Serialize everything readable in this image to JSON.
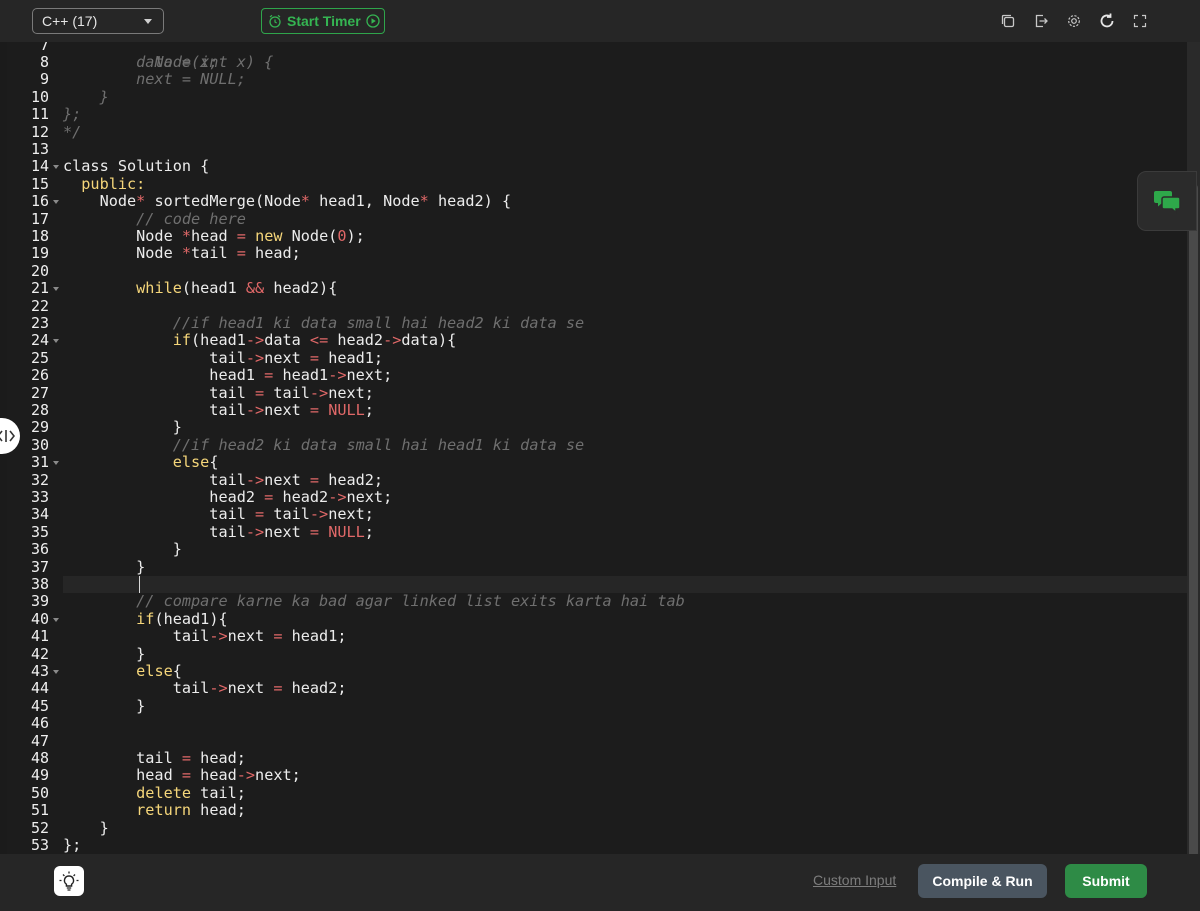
{
  "toolbar": {
    "language": "C++ (17)",
    "timer_label": "Start Timer",
    "icons": [
      "copy-icon",
      "export-icon",
      "settings-icon",
      "reset-icon",
      "fullscreen-icon"
    ]
  },
  "editor": {
    "first_line_partial": "    Node(int x) {",
    "active_line": 38,
    "lines": [
      {
        "n": 8,
        "fold": false,
        "tokens": [
          [
            "cm",
            "        data = x;"
          ]
        ]
      },
      {
        "n": 9,
        "fold": false,
        "tokens": [
          [
            "cm",
            "        next = NULL;"
          ]
        ]
      },
      {
        "n": 10,
        "fold": false,
        "tokens": [
          [
            "cm",
            "    }"
          ]
        ]
      },
      {
        "n": 11,
        "fold": false,
        "tokens": [
          [
            "cm",
            "};"
          ]
        ]
      },
      {
        "n": 12,
        "fold": false,
        "tokens": [
          [
            "cm",
            "*/"
          ]
        ]
      },
      {
        "n": 13,
        "fold": false,
        "tokens": []
      },
      {
        "n": 14,
        "fold": true,
        "tokens": [
          [
            "plain",
            "class Solution {"
          ]
        ]
      },
      {
        "n": 15,
        "fold": false,
        "tokens": [
          [
            "kw",
            "  public:"
          ]
        ]
      },
      {
        "n": 16,
        "fold": true,
        "tokens": [
          [
            "plain",
            "    Node"
          ],
          [
            "op",
            "*"
          ],
          [
            "plain",
            " sortedMerge(Node"
          ],
          [
            "op",
            "*"
          ],
          [
            "plain",
            " head1, Node"
          ],
          [
            "op",
            "*"
          ],
          [
            "plain",
            " head2) {"
          ]
        ]
      },
      {
        "n": 17,
        "fold": false,
        "tokens": [
          [
            "cm",
            "        // code here"
          ]
        ]
      },
      {
        "n": 18,
        "fold": false,
        "tokens": [
          [
            "plain",
            "        Node "
          ],
          [
            "op",
            "*"
          ],
          [
            "plain",
            "head "
          ],
          [
            "op",
            "="
          ],
          [
            "plain",
            " "
          ],
          [
            "kw",
            "new"
          ],
          [
            "plain",
            " Node("
          ],
          [
            "num",
            "0"
          ],
          [
            "plain",
            ");"
          ]
        ]
      },
      {
        "n": 19,
        "fold": false,
        "tokens": [
          [
            "plain",
            "        Node "
          ],
          [
            "op",
            "*"
          ],
          [
            "plain",
            "tail "
          ],
          [
            "op",
            "="
          ],
          [
            "plain",
            " head;"
          ]
        ]
      },
      {
        "n": 20,
        "fold": false,
        "tokens": []
      },
      {
        "n": 21,
        "fold": true,
        "tokens": [
          [
            "plain",
            "        "
          ],
          [
            "kw",
            "while"
          ],
          [
            "plain",
            "(head1 "
          ],
          [
            "op",
            "&&"
          ],
          [
            "plain",
            " head2){"
          ]
        ]
      },
      {
        "n": 22,
        "fold": false,
        "tokens": []
      },
      {
        "n": 23,
        "fold": false,
        "tokens": [
          [
            "cm",
            "            //if head1 ki data small hai head2 ki data se"
          ]
        ]
      },
      {
        "n": 24,
        "fold": true,
        "tokens": [
          [
            "plain",
            "            "
          ],
          [
            "kw",
            "if"
          ],
          [
            "plain",
            "(head1"
          ],
          [
            "op",
            "->"
          ],
          [
            "plain",
            "data "
          ],
          [
            "op",
            "<="
          ],
          [
            "plain",
            " head2"
          ],
          [
            "op",
            "->"
          ],
          [
            "plain",
            "data){"
          ]
        ]
      },
      {
        "n": 25,
        "fold": false,
        "tokens": [
          [
            "plain",
            "                tail"
          ],
          [
            "op",
            "->"
          ],
          [
            "plain",
            "next "
          ],
          [
            "op",
            "="
          ],
          [
            "plain",
            " head1;"
          ]
        ]
      },
      {
        "n": 26,
        "fold": false,
        "tokens": [
          [
            "plain",
            "                head1 "
          ],
          [
            "op",
            "="
          ],
          [
            "plain",
            " head1"
          ],
          [
            "op",
            "->"
          ],
          [
            "plain",
            "next;"
          ]
        ]
      },
      {
        "n": 27,
        "fold": false,
        "tokens": [
          [
            "plain",
            "                tail "
          ],
          [
            "op",
            "="
          ],
          [
            "plain",
            " tail"
          ],
          [
            "op",
            "->"
          ],
          [
            "plain",
            "next;"
          ]
        ]
      },
      {
        "n": 28,
        "fold": false,
        "tokens": [
          [
            "plain",
            "                tail"
          ],
          [
            "op",
            "->"
          ],
          [
            "plain",
            "next "
          ],
          [
            "op",
            "="
          ],
          [
            "plain",
            " "
          ],
          [
            "null",
            "NULL"
          ],
          [
            "plain",
            ";"
          ]
        ]
      },
      {
        "n": 29,
        "fold": false,
        "tokens": [
          [
            "plain",
            "            }"
          ]
        ]
      },
      {
        "n": 30,
        "fold": false,
        "tokens": [
          [
            "cm",
            "            //if head2 ki data small hai head1 ki data se"
          ]
        ]
      },
      {
        "n": 31,
        "fold": true,
        "tokens": [
          [
            "plain",
            "            "
          ],
          [
            "kw",
            "else"
          ],
          [
            "plain",
            "{"
          ]
        ]
      },
      {
        "n": 32,
        "fold": false,
        "tokens": [
          [
            "plain",
            "                tail"
          ],
          [
            "op",
            "->"
          ],
          [
            "plain",
            "next "
          ],
          [
            "op",
            "="
          ],
          [
            "plain",
            " head2;"
          ]
        ]
      },
      {
        "n": 33,
        "fold": false,
        "tokens": [
          [
            "plain",
            "                head2 "
          ],
          [
            "op",
            "="
          ],
          [
            "plain",
            " head2"
          ],
          [
            "op",
            "->"
          ],
          [
            "plain",
            "next;"
          ]
        ]
      },
      {
        "n": 34,
        "fold": false,
        "tokens": [
          [
            "plain",
            "                tail "
          ],
          [
            "op",
            "="
          ],
          [
            "plain",
            " tail"
          ],
          [
            "op",
            "->"
          ],
          [
            "plain",
            "next;"
          ]
        ]
      },
      {
        "n": 35,
        "fold": false,
        "tokens": [
          [
            "plain",
            "                tail"
          ],
          [
            "op",
            "->"
          ],
          [
            "plain",
            "next "
          ],
          [
            "op",
            "="
          ],
          [
            "plain",
            " "
          ],
          [
            "null",
            "NULL"
          ],
          [
            "plain",
            ";"
          ]
        ]
      },
      {
        "n": 36,
        "fold": false,
        "tokens": [
          [
            "plain",
            "            }"
          ]
        ]
      },
      {
        "n": 37,
        "fold": false,
        "tokens": [
          [
            "plain",
            "        }"
          ]
        ]
      },
      {
        "n": 38,
        "fold": false,
        "tokens": []
      },
      {
        "n": 39,
        "fold": false,
        "tokens": [
          [
            "cm",
            "        // compare karne ka bad agar linked list exits karta hai tab"
          ]
        ]
      },
      {
        "n": 40,
        "fold": true,
        "tokens": [
          [
            "plain",
            "        "
          ],
          [
            "kw",
            "if"
          ],
          [
            "plain",
            "(head1){"
          ]
        ]
      },
      {
        "n": 41,
        "fold": false,
        "tokens": [
          [
            "plain",
            "            tail"
          ],
          [
            "op",
            "->"
          ],
          [
            "plain",
            "next "
          ],
          [
            "op",
            "="
          ],
          [
            "plain",
            " head1;"
          ]
        ]
      },
      {
        "n": 42,
        "fold": false,
        "tokens": [
          [
            "plain",
            "        }"
          ]
        ]
      },
      {
        "n": 43,
        "fold": true,
        "tokens": [
          [
            "plain",
            "        "
          ],
          [
            "kw",
            "else"
          ],
          [
            "plain",
            "{"
          ]
        ]
      },
      {
        "n": 44,
        "fold": false,
        "tokens": [
          [
            "plain",
            "            tail"
          ],
          [
            "op",
            "->"
          ],
          [
            "plain",
            "next "
          ],
          [
            "op",
            "="
          ],
          [
            "plain",
            " head2;"
          ]
        ]
      },
      {
        "n": 45,
        "fold": false,
        "tokens": [
          [
            "plain",
            "        }"
          ]
        ]
      },
      {
        "n": 46,
        "fold": false,
        "tokens": []
      },
      {
        "n": 47,
        "fold": false,
        "tokens": []
      },
      {
        "n": 48,
        "fold": false,
        "tokens": [
          [
            "plain",
            "        tail "
          ],
          [
            "op",
            "="
          ],
          [
            "plain",
            " head;"
          ]
        ]
      },
      {
        "n": 49,
        "fold": false,
        "tokens": [
          [
            "plain",
            "        head "
          ],
          [
            "op",
            "="
          ],
          [
            "plain",
            " head"
          ],
          [
            "op",
            "->"
          ],
          [
            "plain",
            "next;"
          ]
        ]
      },
      {
        "n": 50,
        "fold": false,
        "tokens": [
          [
            "plain",
            "        "
          ],
          [
            "kw",
            "delete"
          ],
          [
            "plain",
            " tail;"
          ]
        ]
      },
      {
        "n": 51,
        "fold": false,
        "tokens": [
          [
            "plain",
            "        "
          ],
          [
            "kw",
            "return"
          ],
          [
            "plain",
            " head;"
          ]
        ]
      },
      {
        "n": 52,
        "fold": false,
        "tokens": [
          [
            "plain",
            "    }"
          ]
        ]
      },
      {
        "n": 53,
        "fold": false,
        "tokens": [
          [
            "plain",
            "};"
          ]
        ]
      }
    ]
  },
  "footer": {
    "custom_input_label": "Custom Input",
    "compile_label": "Compile & Run",
    "submit_label": "Submit"
  },
  "colors": {
    "accent_green": "#2e8b46",
    "timer_green": "#35b552",
    "compile_bg": "#4a5560"
  }
}
